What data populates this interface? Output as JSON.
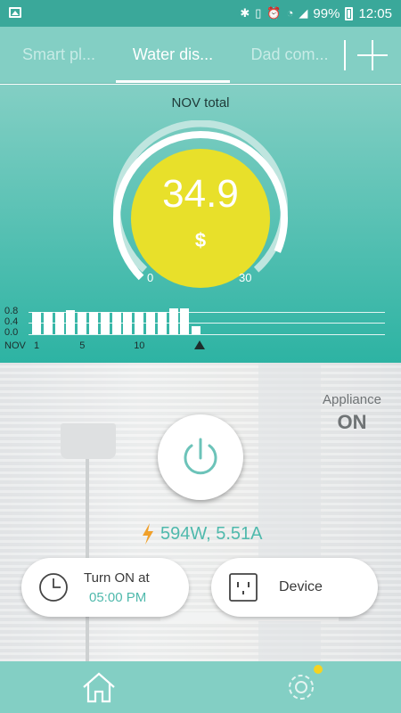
{
  "status_bar": {
    "battery": "99%",
    "time": "12:05"
  },
  "tabs": [
    {
      "label": "Smart pl...",
      "active": false
    },
    {
      "label": "Water dis...",
      "active": true
    },
    {
      "label": "Dad com...",
      "active": false
    }
  ],
  "gauge": {
    "title": "NOV total",
    "value": "34.9",
    "unit": "$",
    "min_label": "0",
    "max_label": "30",
    "fill_fraction": 1.0,
    "color": "#e8e02a"
  },
  "chart_data": {
    "type": "bar",
    "title": "",
    "month_label": "NOV",
    "x_tick_labels": [
      {
        "day": 1,
        "label": "1"
      },
      {
        "day": 5,
        "label": "5"
      },
      {
        "day": 10,
        "label": "10"
      }
    ],
    "y_ticks": [
      "0.8",
      "0.4",
      "0.0"
    ],
    "ylim": [
      0,
      1.0
    ],
    "days": [
      1,
      2,
      3,
      4,
      5,
      6,
      7,
      8,
      9,
      10,
      11,
      12,
      13,
      14,
      15
    ],
    "values": [
      0.82,
      0.8,
      0.8,
      0.87,
      0.8,
      0.82,
      0.82,
      0.8,
      0.82,
      0.82,
      0.8,
      0.82,
      0.95,
      0.93,
      0.3
    ],
    "current_day": 15
  },
  "appliance": {
    "label": "Appliance",
    "state": "ON"
  },
  "reading": {
    "text": "594W, 5.51A"
  },
  "timer_card": {
    "line1": "Turn ON at",
    "line2": "05:00 PM"
  },
  "device_card": {
    "label": "Device"
  },
  "colors": {
    "accent": "#4fb9ac",
    "header": "#83cfc4",
    "status_bar": "#3aa89a",
    "notification": "#f5d321"
  }
}
